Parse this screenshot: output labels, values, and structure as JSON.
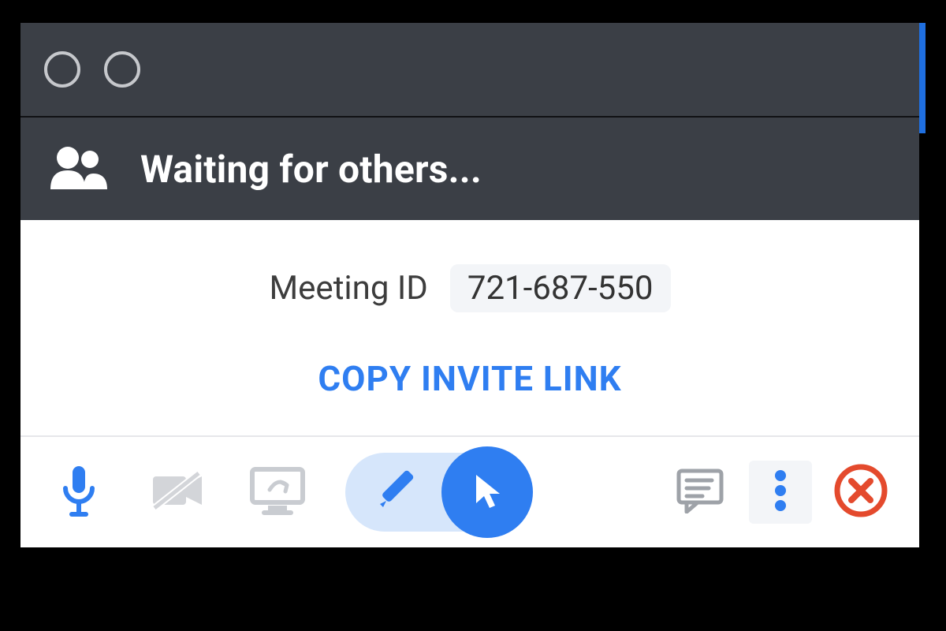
{
  "status": {
    "text": "Waiting for others..."
  },
  "meeting": {
    "label": "Meeting ID",
    "id": "721-687-550",
    "copy_link_label": "COPY INVITE LINK"
  },
  "colors": {
    "accent": "#2f7ef1",
    "danger": "#e44a2d",
    "muted": "#c9ccd1",
    "dark": "#3b3f46"
  }
}
